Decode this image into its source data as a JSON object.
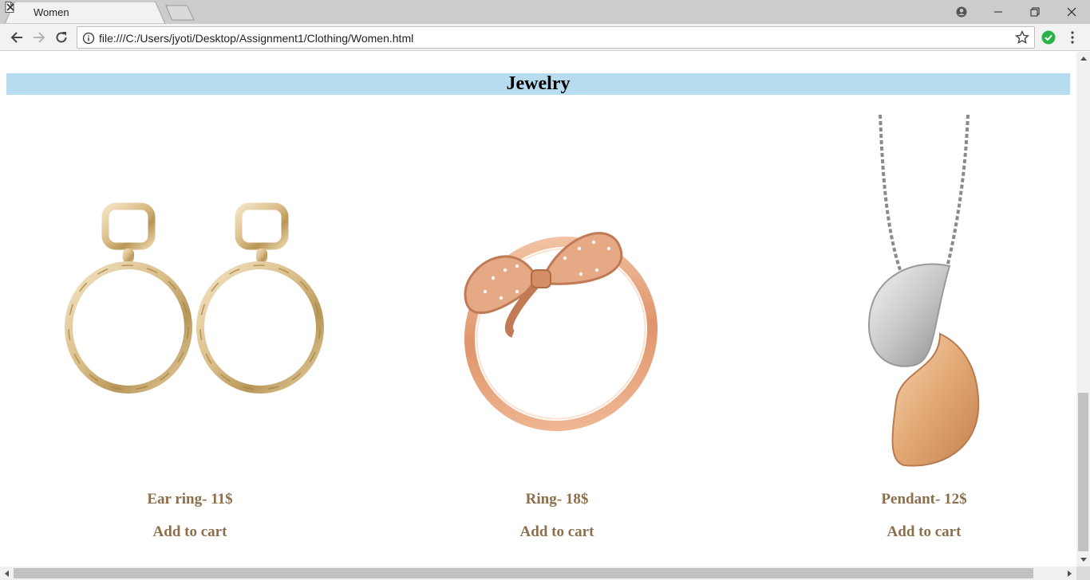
{
  "browser": {
    "tab_title": "Women",
    "url": "file:///C:/Users/jyoti/Desktop/Assignment1/Clothing/Women.html"
  },
  "page": {
    "section_title": "Jewelry",
    "products": [
      {
        "name": "Ear ring- 11$",
        "action": "Add to cart",
        "image": "earrings-image"
      },
      {
        "name": "Ring- 18$",
        "action": "Add to cart",
        "image": "ring-image"
      },
      {
        "name": "Pendant- 12$",
        "action": "Add to cart",
        "image": "pendant-image"
      }
    ]
  },
  "colors": {
    "heading_background": "#b7dcef",
    "product_text": "#8b6f4a",
    "tabstrip": "#cccccc"
  }
}
